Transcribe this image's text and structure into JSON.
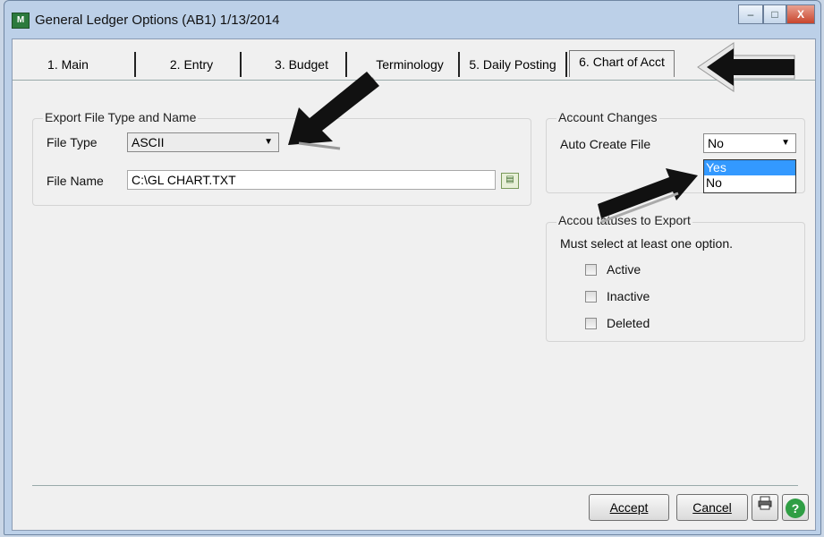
{
  "window": {
    "title": "General Ledger Options (AB1) 1/13/2014",
    "minimize": "–",
    "maximize": "□",
    "close": "X"
  },
  "tabs": [
    {
      "label": "1. Main"
    },
    {
      "label": "2. Entry"
    },
    {
      "label": "3. Budget"
    },
    {
      "label": "4. Terminology"
    },
    {
      "label": "5. Daily Posting"
    },
    {
      "label": "6. Chart of Acct"
    }
  ],
  "tabs_visible": [
    "1. Main",
    "2. Entry",
    "3. Budget",
    "Terminology",
    "5. Daily Posting",
    "6. Chart of Acct"
  ],
  "export_group": {
    "title": "Export File Type and Name",
    "file_type_label": "File Type",
    "file_type_value": "ASCII",
    "file_name_label": "File Name",
    "file_name_value": "C:\\GL CHART.TXT"
  },
  "account_changes": {
    "title": "Account Changes",
    "auto_create_label": "Auto Create File",
    "auto_create_value": "No",
    "dropdown_options": [
      "Yes",
      "No"
    ],
    "highlighted_option": "Yes"
  },
  "status_group": {
    "title_visible": "Accou     tatuses to Export",
    "note": "Must select at least one option.",
    "options": [
      {
        "label": "Active",
        "checked": false
      },
      {
        "label": "Inactive",
        "checked": false
      },
      {
        "label": "Deleted",
        "checked": false
      }
    ]
  },
  "buttons": {
    "accept": "Accept",
    "cancel": "Cancel"
  },
  "colors": {
    "window_frame": "#bcd0e8",
    "client_bg": "#f0f0f0",
    "selection": "#3399ff",
    "help_icon": "#2f9e44",
    "annotation_arrow": "#111111"
  }
}
